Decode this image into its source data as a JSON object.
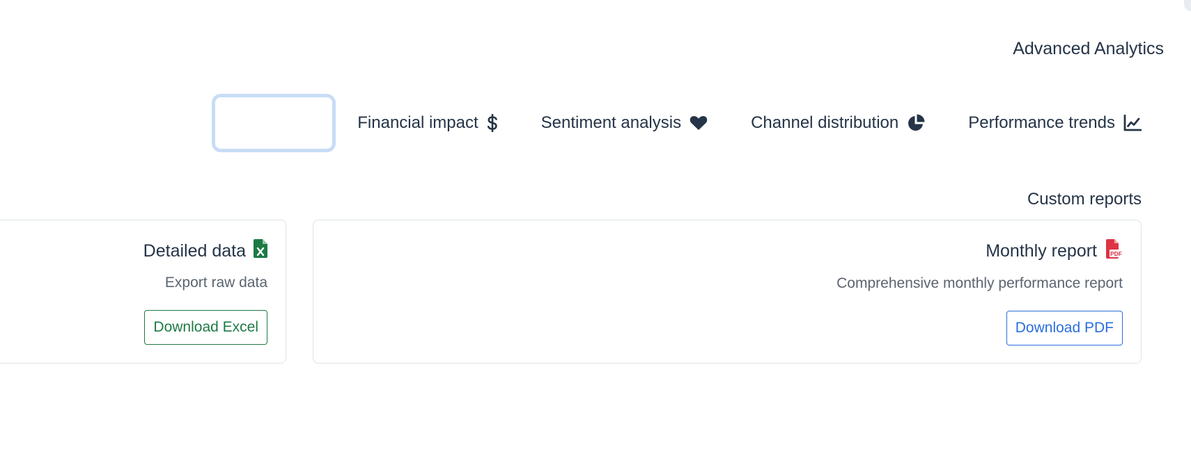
{
  "header": {
    "title": "Advanced Analytics"
  },
  "tabs": [
    {
      "label": "Financial impact",
      "icon": "dollar-icon"
    },
    {
      "label": "Sentiment analysis",
      "icon": "heart-icon"
    },
    {
      "label": "Channel distribution",
      "icon": "pie-chart-icon"
    },
    {
      "label": "Performance trends",
      "icon": "line-chart-icon"
    }
  ],
  "custom_reports": {
    "title": "Custom reports",
    "cards": [
      {
        "title": "Detailed data",
        "icon": "excel-file-icon",
        "icon_color": "#1e7a45",
        "description": "Export raw data",
        "button_label": "Download Excel"
      },
      {
        "title": "Monthly report",
        "icon": "pdf-file-icon",
        "icon_color": "#dc3545",
        "icon_text": "PDF",
        "description": "Comprehensive monthly performance report",
        "button_label": "Download PDF"
      }
    ]
  },
  "colors": {
    "text_primary": "#253447",
    "text_muted": "#5b6470",
    "excel_green": "#1e7a45",
    "pdf_red": "#dc3545",
    "link_blue": "#2a6fdb",
    "focus_ring": "#c8dcf6",
    "card_border": "#dfe3e8"
  }
}
